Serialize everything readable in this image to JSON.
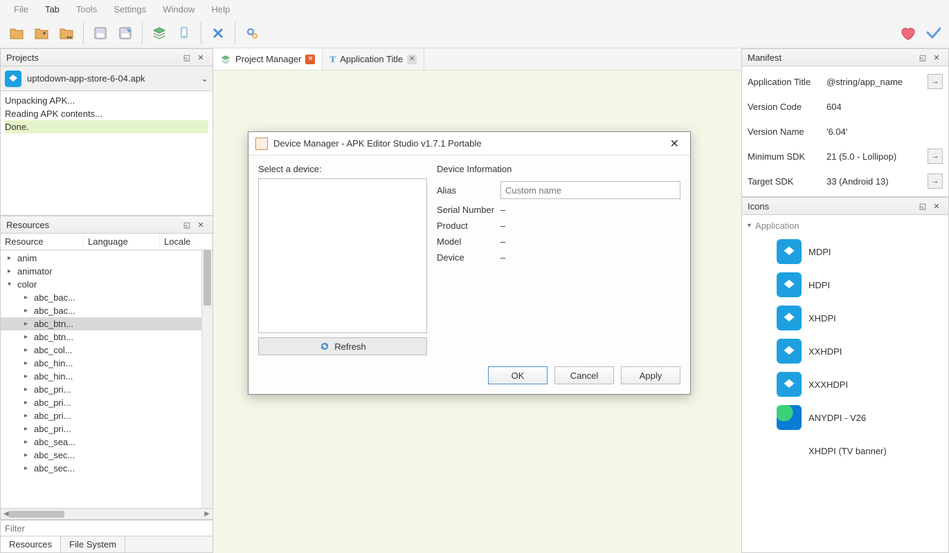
{
  "menu": [
    "File",
    "Tab",
    "Tools",
    "Settings",
    "Window",
    "Help"
  ],
  "menu_active": 1,
  "toolbar_icons": [
    "folder-open",
    "folder-add",
    "folder-cart",
    "save",
    "save-as",
    "layers",
    "device",
    "close-x",
    "gears"
  ],
  "projects_panel": {
    "title": "Projects",
    "selected": "uptodown-app-store-6-04.apk",
    "log": [
      "Unpacking APK...",
      "Reading APK contents...",
      "Done."
    ],
    "done_index": 2
  },
  "resources_panel": {
    "title": "Resources",
    "headers": [
      "Resource",
      "Language",
      "Locale"
    ],
    "tree": [
      {
        "level": 1,
        "label": "anim",
        "expander": ">"
      },
      {
        "level": 1,
        "label": "animator",
        "expander": ">"
      },
      {
        "level": 1,
        "label": "color",
        "expander": "v"
      },
      {
        "level": 2,
        "label": "abc_bac...",
        "expander": ">"
      },
      {
        "level": 2,
        "label": "abc_bac...",
        "expander": ">"
      },
      {
        "level": 2,
        "label": "abc_btn...",
        "expander": ">",
        "selected": true
      },
      {
        "level": 2,
        "label": "abc_btn...",
        "expander": ">"
      },
      {
        "level": 2,
        "label": "abc_col...",
        "expander": ">"
      },
      {
        "level": 2,
        "label": "abc_hin...",
        "expander": ">"
      },
      {
        "level": 2,
        "label": "abc_hin...",
        "expander": ">"
      },
      {
        "level": 2,
        "label": "abc_pri...",
        "expander": ">"
      },
      {
        "level": 2,
        "label": "abc_pri...",
        "expander": ">"
      },
      {
        "level": 2,
        "label": "abc_pri...",
        "expander": ">"
      },
      {
        "level": 2,
        "label": "abc_pri...",
        "expander": ">"
      },
      {
        "level": 2,
        "label": "abc_sea...",
        "expander": ">"
      },
      {
        "level": 2,
        "label": "abc_sec...",
        "expander": ">"
      },
      {
        "level": 2,
        "label": "abc_sec...",
        "expander": ">"
      }
    ],
    "filter_placeholder": "Filter",
    "bottom_tabs": [
      "Resources",
      "File System"
    ],
    "bottom_active": 0
  },
  "center_tabs": [
    {
      "label": "Project Manager",
      "icon": "layers",
      "close": "red",
      "active": true
    },
    {
      "label": "Application Title",
      "icon": "text",
      "close": "gray",
      "active": false
    }
  ],
  "manifest_panel": {
    "title": "Manifest",
    "rows": [
      {
        "label": "Application Title",
        "value": "@string/app_name",
        "go": true
      },
      {
        "label": "Version Code",
        "value": "604"
      },
      {
        "label": "Version Name",
        "value": "'6.04'"
      },
      {
        "label": "Minimum SDK",
        "value": "21 (5.0 - Lollipop)",
        "go": true
      },
      {
        "label": "Target SDK",
        "value": "33 (Android 13)",
        "go": true
      }
    ]
  },
  "icons_panel": {
    "title": "Icons",
    "group": "Application",
    "items": [
      {
        "label": "MDPI",
        "thumb": "app"
      },
      {
        "label": "HDPI",
        "thumb": "app"
      },
      {
        "label": "XHDPI",
        "thumb": "app"
      },
      {
        "label": "XXHDPI",
        "thumb": "app"
      },
      {
        "label": "XXXHDPI",
        "thumb": "app"
      },
      {
        "label": "ANYDPI - V26",
        "thumb": "edge"
      },
      {
        "label": "XHDPI (TV banner)",
        "thumb": "empty"
      }
    ]
  },
  "dialog": {
    "title": "Device Manager - APK Editor Studio v1.7.1 Portable",
    "select_label": "Select a device:",
    "info_label": "Device Information",
    "refresh": "Refresh",
    "alias_label": "Alias",
    "alias_placeholder": "Custom name",
    "info_rows": [
      {
        "k": "Serial Number",
        "v": "–"
      },
      {
        "k": "Product",
        "v": "–"
      },
      {
        "k": "Model",
        "v": "–"
      },
      {
        "k": "Device",
        "v": "–"
      }
    ],
    "buttons": {
      "ok": "OK",
      "cancel": "Cancel",
      "apply": "Apply"
    }
  }
}
